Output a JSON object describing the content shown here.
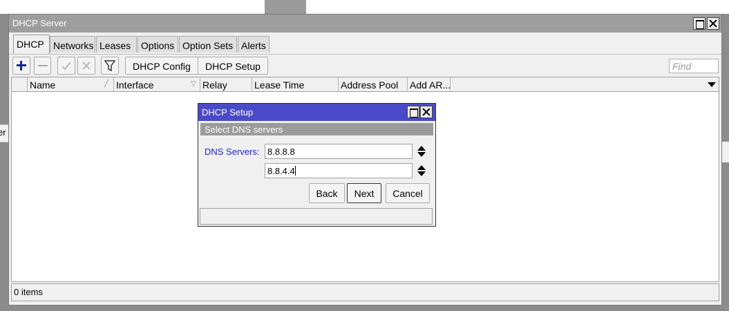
{
  "background": {
    "left_strip_text": "er"
  },
  "window": {
    "title": "DHCP Server",
    "tabs": [
      "DHCP",
      "Networks",
      "Leases",
      "Options",
      "Option Sets",
      "Alerts"
    ],
    "toolbar": {
      "dhcp_config": "DHCP Config",
      "dhcp_setup": "DHCP Setup",
      "find_placeholder": "Find"
    },
    "columns": [
      "Name",
      "Interface",
      "Relay",
      "Lease Time",
      "Address Pool",
      "Add AR..."
    ],
    "status": "0 items"
  },
  "dialog": {
    "title": "DHCP Setup",
    "subtitle": "Select DNS servers",
    "dns_label": "DNS Servers:",
    "dns_servers": [
      "8.8.8.8",
      "8.8.4.4"
    ],
    "buttons": {
      "back": "Back",
      "next": "Next",
      "cancel": "Cancel"
    }
  },
  "colors": {
    "dialog_title": "#4a4ac8",
    "window_title": "#9e9e9e",
    "label_blue": "#1e1ec8",
    "add_icon": "#14289a"
  }
}
